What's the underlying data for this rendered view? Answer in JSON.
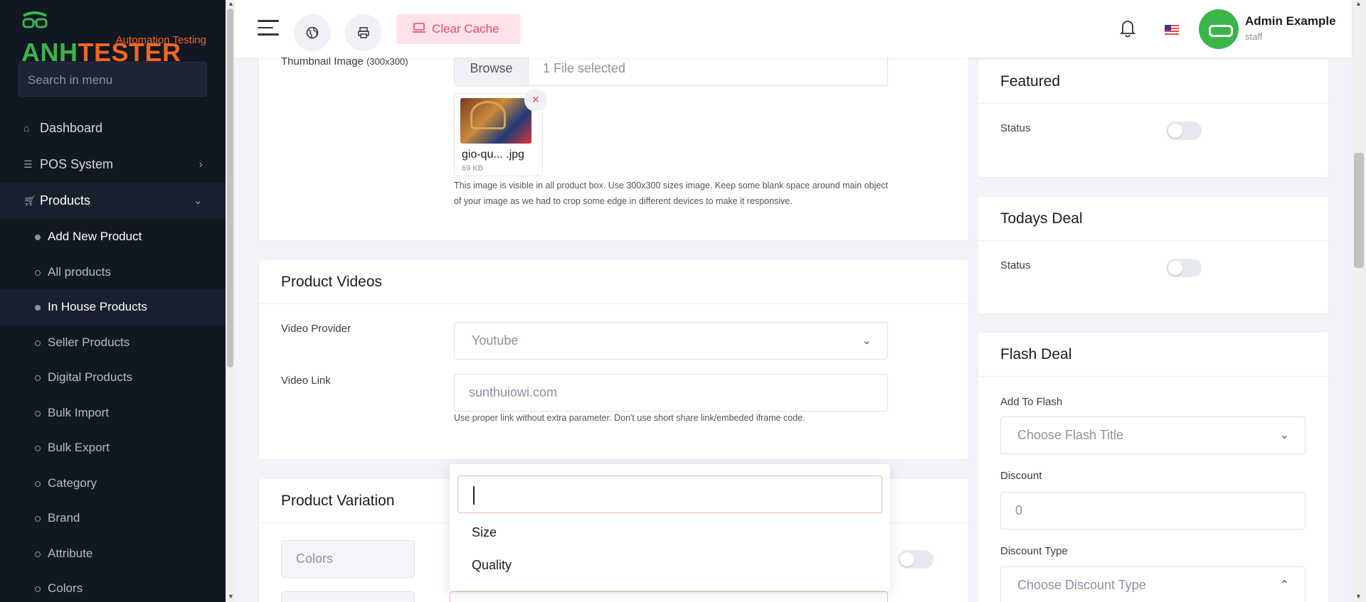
{
  "sidebar": {
    "logo": {
      "text_green": "ANH",
      "text_orange": "TESTER",
      "tagline": "Automation Testing"
    },
    "search_placeholder": "Search in menu",
    "items": [
      {
        "label": "Dashboard",
        "icon": "home-icon"
      },
      {
        "label": "POS System",
        "icon": "list-icon"
      },
      {
        "label": "Products",
        "icon": "cart-icon"
      }
    ],
    "sub_items": [
      {
        "label": "Add New Product"
      },
      {
        "label": "All products"
      },
      {
        "label": "In House Products"
      },
      {
        "label": "Seller Products"
      },
      {
        "label": "Digital Products"
      },
      {
        "label": "Bulk Import"
      },
      {
        "label": "Bulk Export"
      },
      {
        "label": "Category"
      },
      {
        "label": "Brand"
      },
      {
        "label": "Attribute"
      },
      {
        "label": "Colors"
      }
    ]
  },
  "topbar": {
    "clear_cache": "Clear Cache",
    "user_name": "Admin Example",
    "user_role": "staff"
  },
  "thumbnail": {
    "label": "Thumbnail Image",
    "label_size": "(300x300)",
    "browse": "Browse",
    "files_selected": "1 File selected",
    "file_name": "gio-qu... .jpg",
    "file_size": "69 KB",
    "help": "This image is visible in all product box. Use 300x300 sizes image. Keep some blank space around main object of your image as we had to crop some edge in different devices to make it responsive."
  },
  "videos": {
    "title": "Product Videos",
    "provider_label": "Video Provider",
    "provider_value": "Youtube",
    "link_label": "Video Link",
    "link_value": "sunthuiowi.com",
    "help": "Use proper link without extra parameter. Don't use short share link/embeded iframe code."
  },
  "variation": {
    "title": "Product Variation",
    "colors_label": "Colors",
    "popup_options": [
      "Size",
      "Quality"
    ]
  },
  "featured": {
    "title": "Featured",
    "status_label": "Status"
  },
  "todays_deal": {
    "title": "Todays Deal",
    "status_label": "Status"
  },
  "flash_deal": {
    "title": "Flash Deal",
    "add_label": "Add To Flash",
    "add_placeholder": "Choose Flash Title",
    "discount_label": "Discount",
    "discount_value": "0",
    "type_label": "Discount Type",
    "type_placeholder": "Choose Discount Type"
  },
  "colors": {
    "accent": "#ef486a",
    "sidebar_bg": "#111723",
    "brand_green": "#39b54a",
    "brand_orange": "#f26522"
  }
}
